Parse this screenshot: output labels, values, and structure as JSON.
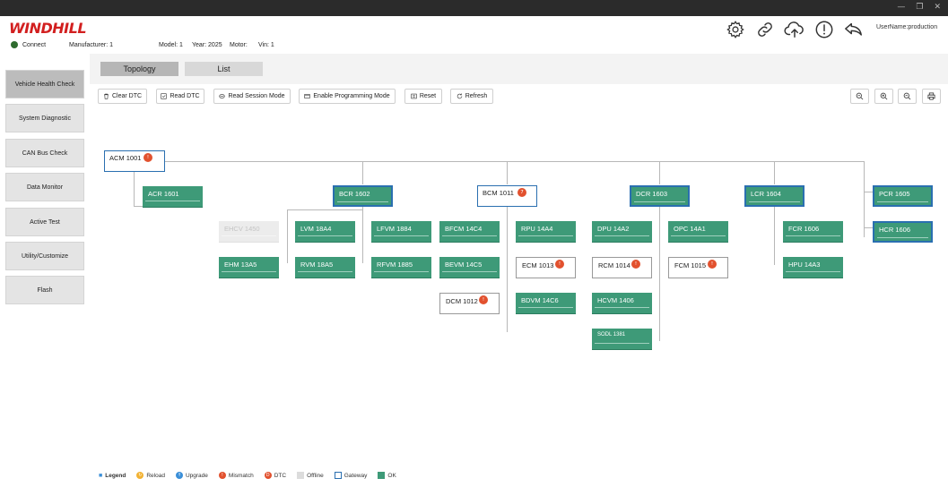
{
  "app": {
    "logo": "WINDHILL",
    "window_controls": [
      "—",
      "❐",
      "✕"
    ]
  },
  "status": {
    "connection": "Connect",
    "manufacturer": "Manufacturer: 1",
    "model": "Model: 1",
    "year": "Year: 2025",
    "motor": "Motor:",
    "vin": "Vin: 1"
  },
  "header": {
    "username": "UserName:production",
    "icons": [
      "gear-icon",
      "link-icon",
      "cloud-upload-icon",
      "alert-icon",
      "back-arrow-icon"
    ]
  },
  "sidebar": {
    "items": [
      {
        "label": "Vehicle Health Check",
        "active": true
      },
      {
        "label": "System Diagnostic"
      },
      {
        "label": "CAN Bus Check"
      },
      {
        "label": "Data Monitor"
      },
      {
        "label": "Active Test"
      },
      {
        "label": "Utility/Customize"
      },
      {
        "label": "Flash"
      }
    ]
  },
  "tabs": {
    "topology": "Topology",
    "list": "List"
  },
  "toolbar": {
    "clear_dtc": "Clear DTC",
    "read_dtc": "Read DTC",
    "read_session": "Read Session Mode",
    "enable_programming": "Enable Programming Mode",
    "reset": "Reset",
    "refresh": "Refresh"
  },
  "nodes": {
    "acm": {
      "label": "ACM 1001",
      "dtc": "!"
    },
    "acr": {
      "label": "ACR 1601"
    },
    "bcr": {
      "label": "BCR 1602"
    },
    "bcm": {
      "label": "BCM 1011",
      "dtc": "7"
    },
    "dcr": {
      "label": "DCR 1603"
    },
    "lcr": {
      "label": "LCR 1604"
    },
    "pcr": {
      "label": "PCR 1605"
    },
    "hcr": {
      "label": "HCR 1606"
    },
    "ehcv": {
      "label": "EHCV 1450"
    },
    "lvm": {
      "label": "LVM 18A4"
    },
    "lfvm": {
      "label": "LFVM 1884"
    },
    "ehm": {
      "label": "EHM 13A5"
    },
    "rvm": {
      "label": "RVM 18A5"
    },
    "rfvm": {
      "label": "RFVM 1885"
    },
    "bfcm": {
      "label": "BFCM 14C4"
    },
    "rpu": {
      "label": "RPU 14A4"
    },
    "bevm": {
      "label": "BEVM 14C5"
    },
    "ecm": {
      "label": "ECM 1013",
      "dtc": "!"
    },
    "dcm": {
      "label": "DCM 1012",
      "dtc": "!"
    },
    "bdvm": {
      "label": "BDVM 14C6"
    },
    "dpu": {
      "label": "DPU 14A2"
    },
    "opc": {
      "label": "OPC 14A1"
    },
    "rcm": {
      "label": "RCM 1014",
      "dtc": "!"
    },
    "fcm": {
      "label": "FCM 1015",
      "dtc": "!"
    },
    "hcvm": {
      "label": "HCVM 1406"
    },
    "sodl": {
      "label": "SODL 1381"
    },
    "fcr": {
      "label": "FCR 1606"
    },
    "hpu": {
      "label": "HPU 14A3"
    }
  },
  "legend": {
    "title": "Legend",
    "reload": "Reload",
    "upgrade": "Upgrade",
    "mismatch": "Mismatch",
    "dtc": "DTC",
    "offline": "Offline",
    "gateway": "Gateway",
    "ok": "OK",
    "colors": {
      "reload": "#f2b233",
      "upgrade": "#3b8fd8",
      "mismatch": "#e2512e",
      "dtc": "#e2512e",
      "offline": "#dcdcdc",
      "gateway": "#2a6fb0",
      "ok": "#3e9a78"
    }
  }
}
